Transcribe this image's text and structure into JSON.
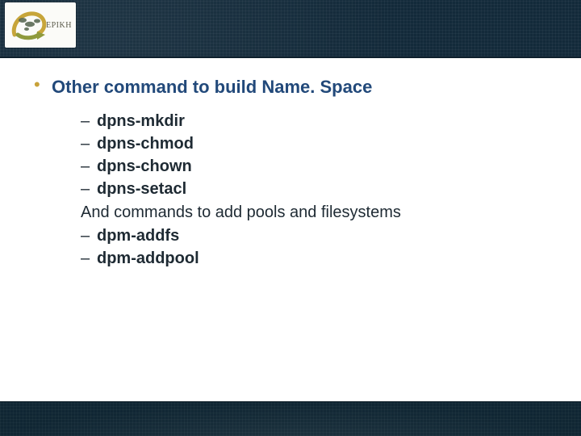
{
  "logo": {
    "label": "EPIKH"
  },
  "heading": {
    "bullet": "•",
    "text": "Other command to build Name. Space"
  },
  "items": [
    {
      "type": "cmd",
      "dash": "–",
      "text": "dpns-mkdir"
    },
    {
      "type": "cmd",
      "dash": "–",
      "text": "dpns-chmod"
    },
    {
      "type": "cmd",
      "dash": "–",
      "text": "dpns-chown"
    },
    {
      "type": "cmd",
      "dash": "–",
      "text": "dpns-setacl"
    },
    {
      "type": "note",
      "text": "And commands to add pools and filesystems"
    },
    {
      "type": "cmd",
      "dash": "–",
      "text": "dpm-addfs"
    },
    {
      "type": "cmd",
      "dash": "–",
      "text": "dpm-addpool"
    }
  ]
}
